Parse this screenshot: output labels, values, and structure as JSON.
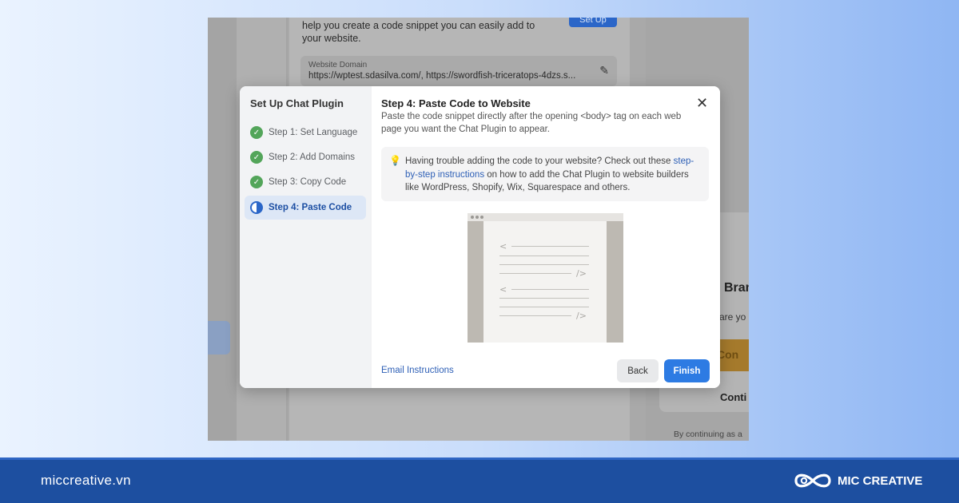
{
  "background": {
    "description_text": "help you create a code snippet you can easily add to your website.",
    "setup_button": "Set Up",
    "domain_label": "Website Domain",
    "domain_value": "https://wptest.sdasilva.com/, https://swordfish-triceratops-4dzs.s...",
    "right_bran": "Bran",
    "right_are": "are yo",
    "right_con": "Con",
    "right_conti": "Conti",
    "right_by_continuing": "By continuing as a"
  },
  "modal": {
    "sidebar_title": "Set Up Chat Plugin",
    "steps": [
      {
        "label": "Step 1: Set Language",
        "status": "complete"
      },
      {
        "label": "Step 2: Add Domains",
        "status": "complete"
      },
      {
        "label": "Step 3: Copy Code",
        "status": "complete"
      },
      {
        "label": "Step 4: Paste Code",
        "status": "active"
      }
    ],
    "title": "Step 4: Paste Code to Website",
    "description": "Paste the code snippet directly after the opening <body> tag on each web page you want the Chat Plugin to appear.",
    "tip": {
      "text_before": "Having trouble adding the code to your website? Check out these ",
      "link": "step-by-step instructions",
      "text_after": " on how to add the Chat Plugin to website builders like WordPress, Shopify, Wix, Squarespace and others."
    },
    "email_link": "Email Instructions",
    "back_button": "Back",
    "finish_button": "Finish",
    "close_glyph": "✕"
  },
  "footer": {
    "site": "miccreative.vn",
    "brand": "MIC CREATIVE"
  },
  "colors": {
    "accent": "#2d7be3",
    "footer": "#1d4fa0",
    "check": "#53a55a"
  }
}
